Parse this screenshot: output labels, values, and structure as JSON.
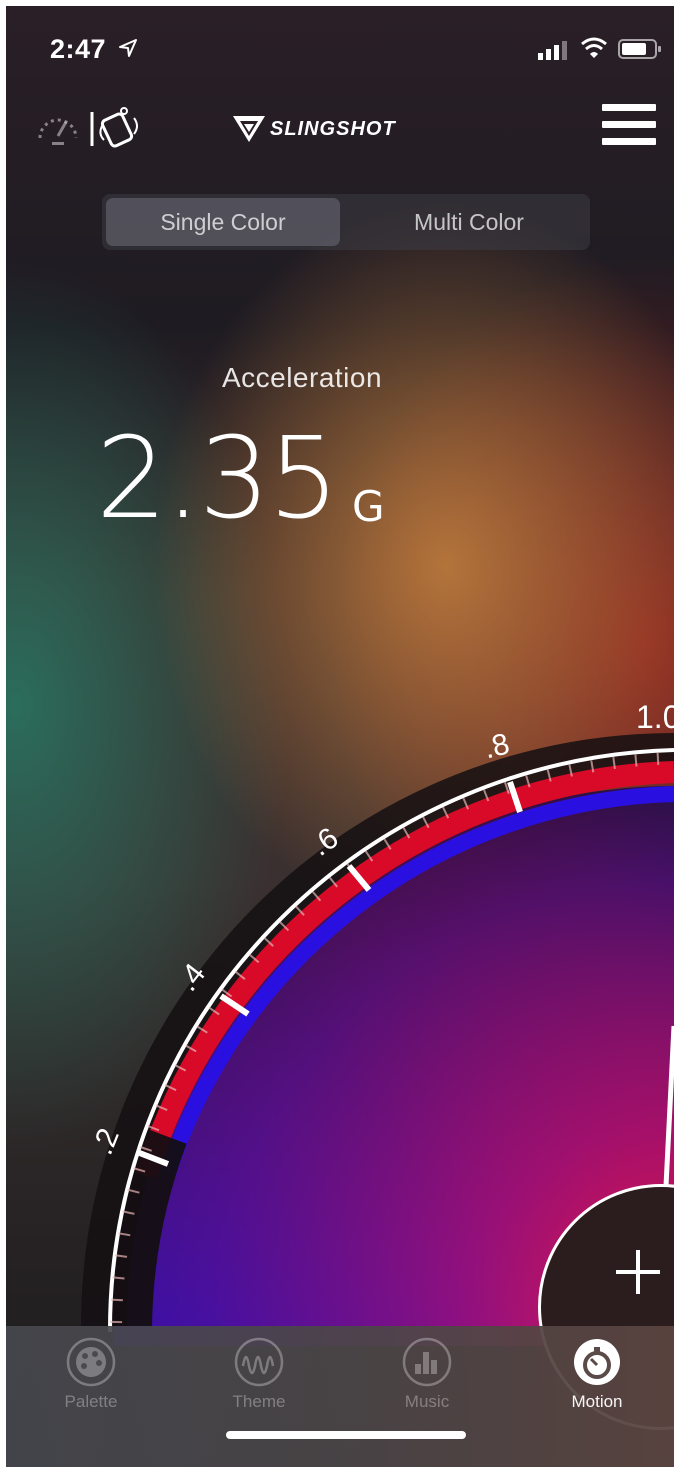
{
  "status_bar": {
    "time": "2:47"
  },
  "header": {
    "logo_text": "SLINGSHOT"
  },
  "segmented": {
    "single": "Single Color",
    "multi": "Multi Color"
  },
  "readout": {
    "label": "Acceleration",
    "value": "2.35",
    "unit": "G"
  },
  "gauge": {
    "tick_labels": [
      ".2",
      ".4",
      ".6",
      ".8",
      "1.0"
    ]
  },
  "tabs": [
    {
      "label": "Palette",
      "icon": "palette-icon",
      "active": false
    },
    {
      "label": "Theme",
      "icon": "theme-wave-icon",
      "active": false
    },
    {
      "label": "Music",
      "icon": "music-bars-icon",
      "active": false
    },
    {
      "label": "Motion",
      "icon": "motion-stopwatch-icon",
      "active": true
    }
  ],
  "colors": {
    "gauge_red": "#e0102a",
    "gauge_blue": "#3a0ff0",
    "white": "#ffffff"
  }
}
